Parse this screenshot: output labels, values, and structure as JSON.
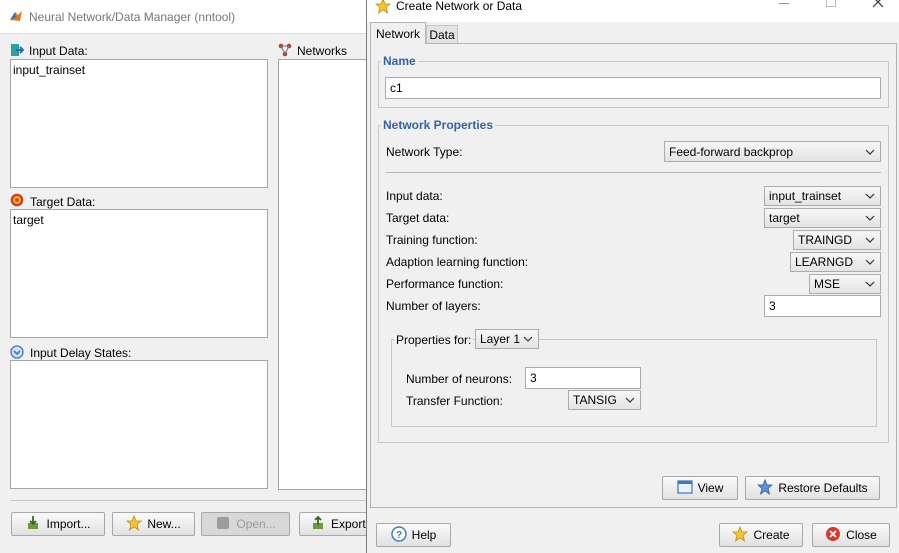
{
  "manager": {
    "title": "Neural Network/Data Manager (nntool)",
    "input_data_label": "Input Data:",
    "input_data_items": [
      "input_trainset"
    ],
    "networks_label": "Networks",
    "target_data_label": "Target Data:",
    "target_data_items": [
      "target"
    ],
    "input_delay_label": "Input Delay States:",
    "buttons": {
      "import": "Import...",
      "new": "New...",
      "open": "Open...",
      "export": "Export"
    }
  },
  "dialog": {
    "title": "Create Network or Data",
    "tabs": [
      "Network",
      "Data"
    ],
    "name_group": "Name",
    "name_value": "c1",
    "props_group": "Network Properties",
    "network_type_label": "Network Type:",
    "network_type_value": "Feed-forward backprop",
    "rows": [
      {
        "label": "Input data:",
        "value": "input_trainset"
      },
      {
        "label": "Target data:",
        "value": "target"
      },
      {
        "label": "Training function:",
        "value": "TRAINGD"
      },
      {
        "label": "Adaption learning function:",
        "value": "LEARNGD"
      },
      {
        "label": "Performance function:",
        "value": "MSE"
      }
    ],
    "layers_label": "Number of layers:",
    "layers_value": "3",
    "properties_for_label": "Properties for:",
    "properties_for_value": "Layer 1",
    "neurons_label": "Number of neurons:",
    "neurons_value": "3",
    "transfer_label": "Transfer Function:",
    "transfer_value": "TANSIG",
    "buttons": {
      "view": "View",
      "restore": "Restore Defaults",
      "help": "Help",
      "create": "Create",
      "close": "Close"
    }
  },
  "colors": {
    "accent_title": "#3464a8",
    "background": "#f0f0f0"
  }
}
